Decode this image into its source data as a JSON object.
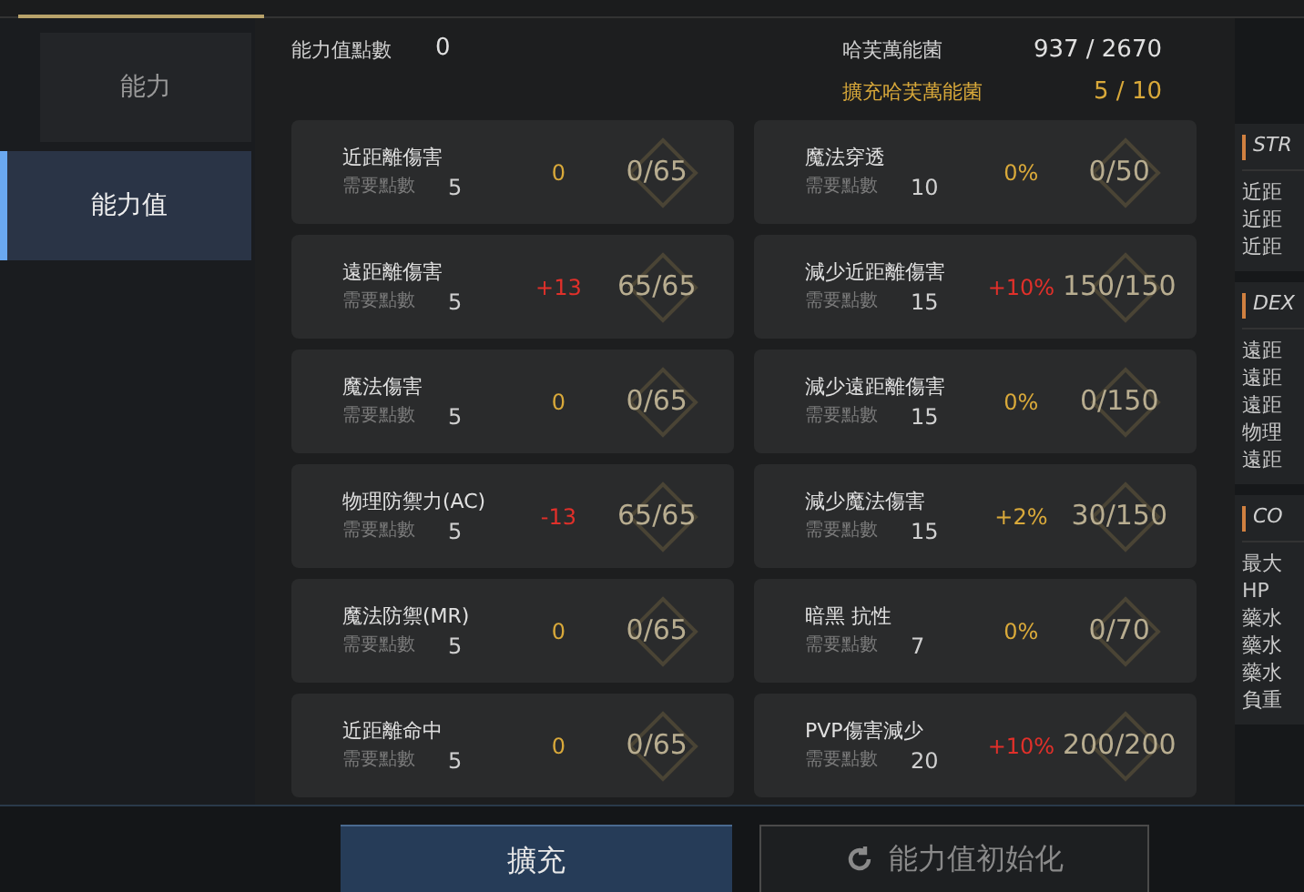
{
  "sidebar": {
    "items": [
      {
        "label": "能力",
        "selected": false
      },
      {
        "label": "能力值",
        "selected": true
      }
    ]
  },
  "header": {
    "points_label": "能力值點數",
    "points_value": "0",
    "resource_label": "哈芙萬能菌",
    "resource_value": "937 / 2670",
    "expand_label": "擴充哈芙萬能菌",
    "expand_value": "5 / 10"
  },
  "stats": [
    {
      "name": "近距離傷害",
      "cost_label": "需要點數",
      "cost": "5",
      "bonus": "0",
      "value": "0/65",
      "maxed": false
    },
    {
      "name": "魔法穿透",
      "cost_label": "需要點數",
      "cost": "10",
      "bonus": "0%",
      "value": "0/50",
      "maxed": false
    },
    {
      "name": "遠距離傷害",
      "cost_label": "需要點數",
      "cost": "5",
      "bonus": "+13",
      "value": "65/65",
      "maxed": true
    },
    {
      "name": "減少近距離傷害",
      "cost_label": "需要點數",
      "cost": "15",
      "bonus": "+10%",
      "value": "150/150",
      "maxed": true
    },
    {
      "name": "魔法傷害",
      "cost_label": "需要點數",
      "cost": "5",
      "bonus": "0",
      "value": "0/65",
      "maxed": false
    },
    {
      "name": "減少遠距離傷害",
      "cost_label": "需要點數",
      "cost": "15",
      "bonus": "0%",
      "value": "0/150",
      "maxed": false
    },
    {
      "name": "物理防禦力(AC)",
      "cost_label": "需要點數",
      "cost": "5",
      "bonus": "-13",
      "value": "65/65",
      "maxed": true
    },
    {
      "name": "減少魔法傷害",
      "cost_label": "需要點數",
      "cost": "15",
      "bonus": "+2%",
      "value": "30/150",
      "maxed": false
    },
    {
      "name": "魔法防禦(MR)",
      "cost_label": "需要點數",
      "cost": "5",
      "bonus": "0",
      "value": "0/65",
      "maxed": false
    },
    {
      "name": "暗黑 抗性",
      "cost_label": "需要點數",
      "cost": "7",
      "bonus": "0%",
      "value": "0/70",
      "maxed": false
    },
    {
      "name": "近距離命中",
      "cost_label": "需要點數",
      "cost": "5",
      "bonus": "0",
      "value": "0/65",
      "maxed": false
    },
    {
      "name": "PVP傷害減少",
      "cost_label": "需要點數",
      "cost": "20",
      "bonus": "+10%",
      "value": "200/200",
      "maxed": true
    }
  ],
  "side_panel": [
    {
      "title": "STR",
      "lines": [
        "近距",
        "近距",
        "近距"
      ]
    },
    {
      "title": "DEX",
      "lines": [
        "遠距",
        "遠距",
        "遠距",
        "物理",
        "遠距"
      ]
    },
    {
      "title": "CO",
      "lines": [
        "最大",
        "HP",
        "藥水",
        "藥水",
        "藥水",
        "負重"
      ]
    }
  ],
  "buttons": {
    "expand": "擴充",
    "reset": "能力值初始化"
  }
}
